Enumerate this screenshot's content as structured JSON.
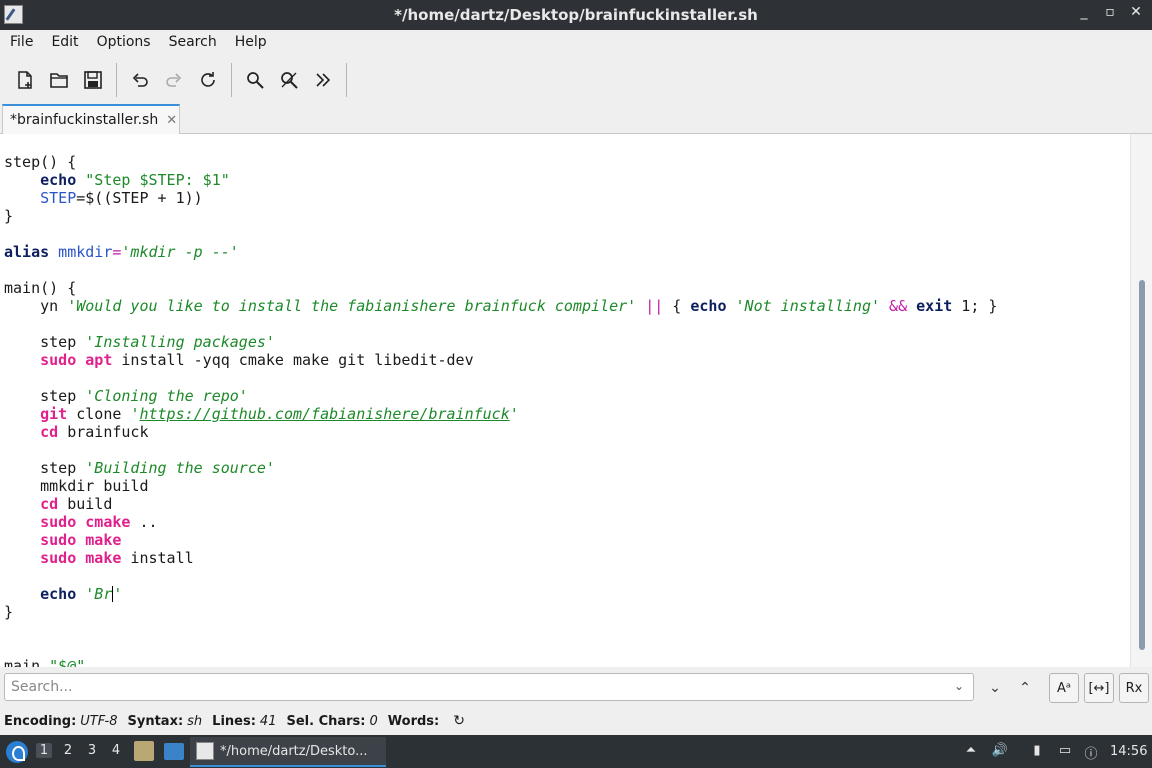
{
  "window": {
    "title": "*/home/dartz/Desktop/brainfuckinstaller.sh",
    "controls": [
      "_",
      "▫",
      "✕"
    ]
  },
  "menu": [
    "File",
    "Edit",
    "Options",
    "Search",
    "Help"
  ],
  "toolbar": {
    "icons": [
      "new-file-icon",
      "open-folder-icon",
      "save-icon",
      "undo-icon",
      "redo-icon",
      "reload-icon",
      "find-icon",
      "replace-icon",
      "more-icon"
    ]
  },
  "tab": {
    "label": "*brainfuckinstaller.sh",
    "close": "✕"
  },
  "code": {
    "step_def": "step() {",
    "echo_kw": "echo",
    "echo_str": "\"Step $STEP: $1\"",
    "step_var": "STEP",
    "step_expr": "=$((STEP + 1))",
    "close_brace": "}",
    "alias_kw": "alias",
    "alias_name": " mmkdir",
    "alias_eq": "=",
    "alias_val": "'mkdir -p --'",
    "main_def": "main() {",
    "yn": "yn ",
    "yn_str": "'Would you like to install the fabianishere brainfuck compiler'",
    "or_op": "||",
    "brace_open": " { ",
    "not_install": "'Not installing'",
    "and_op": "&&",
    "exit_kw": "exit",
    "exit_rest": " 1; }",
    "step_cmd": "step ",
    "s1": "'Installing packages'",
    "sudo": "sudo",
    "apt": "apt",
    "apt_rest": " install -yqq cmake make git libedit-dev",
    "s2": "'Cloning the repo'",
    "git": "git",
    "clone": " clone ",
    "url_q1": "'",
    "url": "https://github.com/fabianishere/brainfuck",
    "url_q2": "'",
    "cd": "cd",
    "cd1": " brainfuck",
    "s3": "'Building the source'",
    "mmkdir": "mmkdir build",
    "cd2": " build",
    "cmake": "cmake",
    "cmake_rest": " ..",
    "make": "make",
    "install": " install",
    "echo2": "echo",
    "echo2_str1": "'Br",
    "echo2_str2": "'",
    "main_call": "main ",
    "main_arg": "\"$@\""
  },
  "search": {
    "placeholder": "Search...",
    "value": ""
  },
  "search_buttons": {
    "down": "⌄",
    "up": "⌃",
    "case": "Aᵃ",
    "word": "[↔]",
    "regex": "Rx"
  },
  "status": {
    "encoding_label": "Encoding:",
    "encoding": "UTF-8",
    "syntax_label": "Syntax:",
    "syntax": "sh",
    "lines_label": "Lines:",
    "lines": "41",
    "sel_label": "Sel. Chars:",
    "sel": "0",
    "words_label": "Words:",
    "words": ""
  },
  "taskbar": {
    "workspaces": [
      "1",
      "2",
      "3",
      "4"
    ],
    "task": "*/home/dartz/Deskto...",
    "clock": "14:56"
  }
}
